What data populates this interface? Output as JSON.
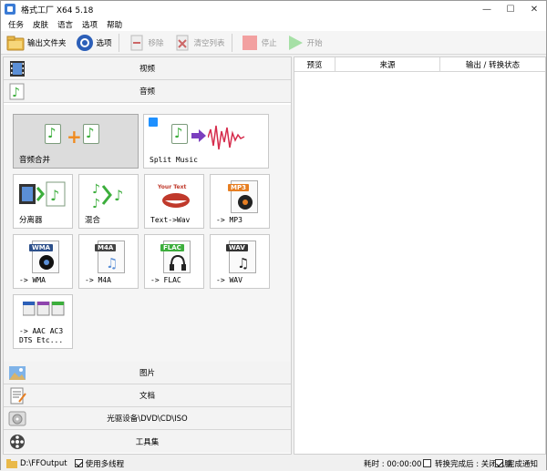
{
  "window": {
    "title": "格式工厂 X64 5.18"
  },
  "menu": [
    "任务",
    "皮肤",
    "语言",
    "选项",
    "帮助"
  ],
  "toolbar": {
    "output_folder": "输出文件夹",
    "options": "选项",
    "remove": "移除",
    "clear_list": "清空列表",
    "stop": "停止",
    "start": "开始"
  },
  "categories": {
    "video": "视频",
    "audio": "音频",
    "picture": "图片",
    "document": "文档",
    "rom": "光驱设备\\DVD\\CD\\ISO",
    "tools": "工具集"
  },
  "tiles": [
    {
      "label": "音频合并"
    },
    {
      "label": "Split Music"
    },
    {
      "label": "分离器"
    },
    {
      "label": "混合"
    },
    {
      "label": "Text->Wav",
      "badge": "Your Text"
    },
    {
      "label": "-> MP3",
      "badge": "MP3"
    },
    {
      "label": "-> WMA",
      "badge": "WMA"
    },
    {
      "label": "-> M4A",
      "badge": "M4A"
    },
    {
      "label": "-> FLAC",
      "badge": "FLAC"
    },
    {
      "label": "-> WAV",
      "badge": "WAV"
    },
    {
      "label": "-> AAC AC3 DTS Etc..."
    }
  ],
  "task_list": {
    "col_preview": "预览",
    "col_source": "来源",
    "col_output": "输出 / 转换状态"
  },
  "status": {
    "output_path": "D:\\FFOutput",
    "multithread": "使用多线程",
    "elapsed": "耗时 : 00:00:00",
    "after_done": "转换完成后 : 关闭电脑",
    "notify": "完成通知"
  },
  "colors": {
    "accent_green": "#3cae3c",
    "stop_red": "#e03030",
    "start_green": "#5cc85c"
  }
}
